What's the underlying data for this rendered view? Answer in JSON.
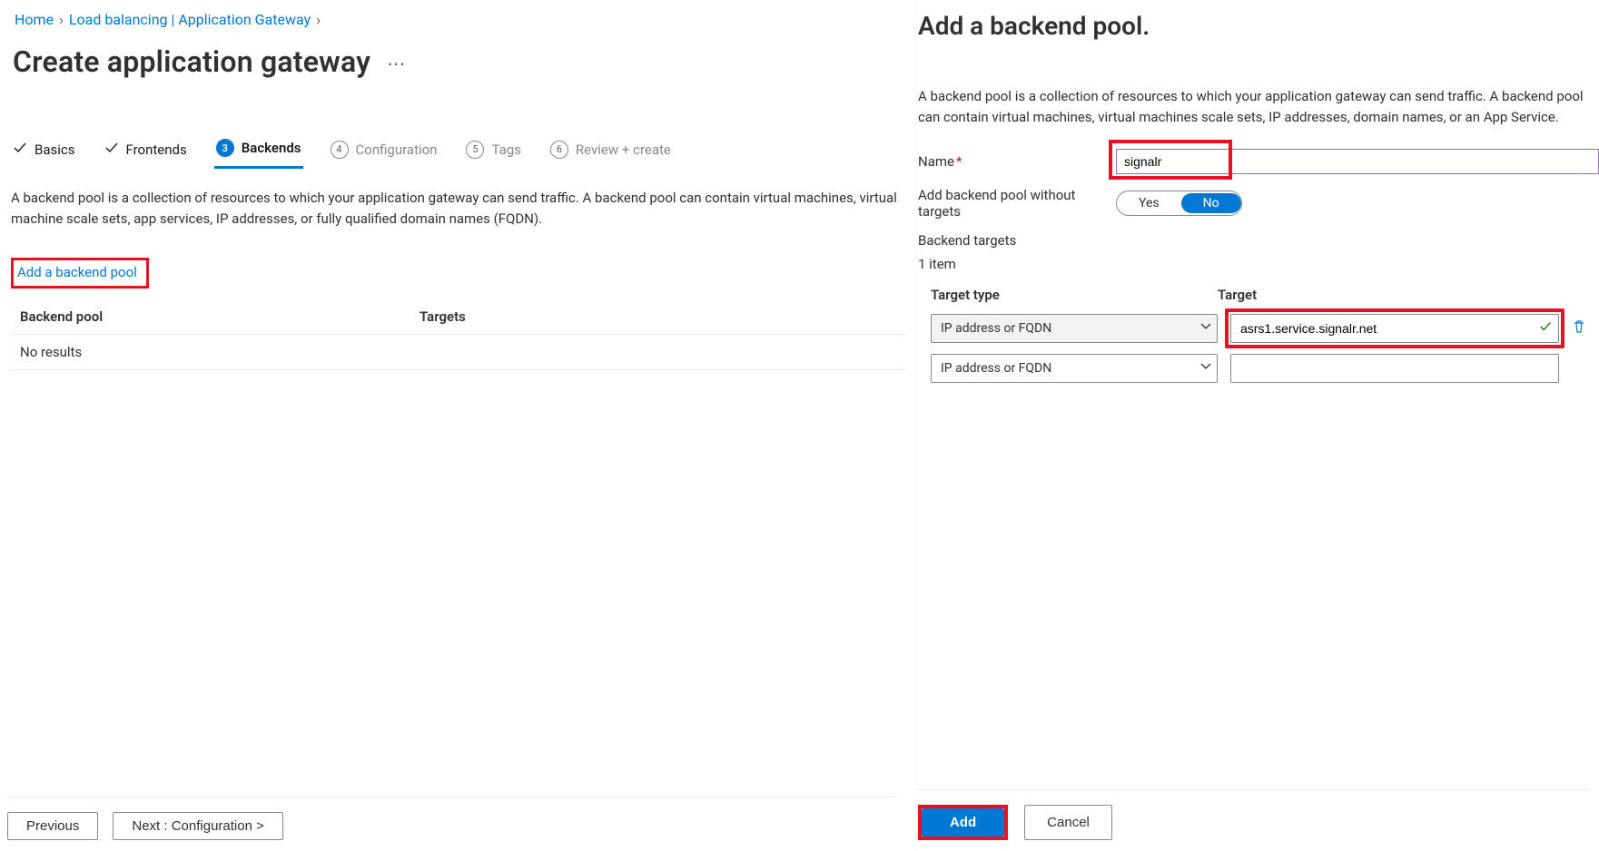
{
  "breadcrumb": {
    "home": "Home",
    "lb": "Load balancing | Application Gateway"
  },
  "page": {
    "title": "Create application gateway"
  },
  "steps": {
    "s1": "Basics",
    "s2": "Frontends",
    "s3": "Backends",
    "s4": "Configuration",
    "s5": "Tags",
    "s6": "Review + create",
    "n4": "4",
    "n5": "5",
    "n6": "6"
  },
  "backends": {
    "desc": "A backend pool is a collection of resources to which your application gateway can send traffic. A backend pool can contain virtual machines, virtual machine scale sets, app services, IP addresses, or fully qualified domain names (FQDN).",
    "addLink": "Add a backend pool",
    "col1": "Backend pool",
    "col2": "Targets",
    "empty": "No results"
  },
  "footer": {
    "prev": "Previous",
    "next": "Next : Configuration >"
  },
  "panel": {
    "title": "Add a backend pool.",
    "desc": "A backend pool is a collection of resources to which your application gateway can send traffic. A backend pool can contain virtual machines, virtual machines scale sets, IP addresses, domain names, or an App Service.",
    "nameLabel": "Name",
    "nameValue": "signalr",
    "noTargetsLabel": "Add backend pool without targets",
    "toggleYes": "Yes",
    "toggleNo": "No",
    "targetsLabel": "Backend targets",
    "itemCount": "1 item",
    "colType": "Target type",
    "colTarget": "Target",
    "rows": [
      {
        "type": "IP address or FQDN",
        "target": "asrs1.service.signalr.net",
        "valid": true,
        "shaded": true,
        "deletable": true
      },
      {
        "type": "IP address or FQDN",
        "target": "",
        "valid": false,
        "shaded": false,
        "deletable": false
      }
    ],
    "addBtn": "Add",
    "cancelBtn": "Cancel"
  }
}
